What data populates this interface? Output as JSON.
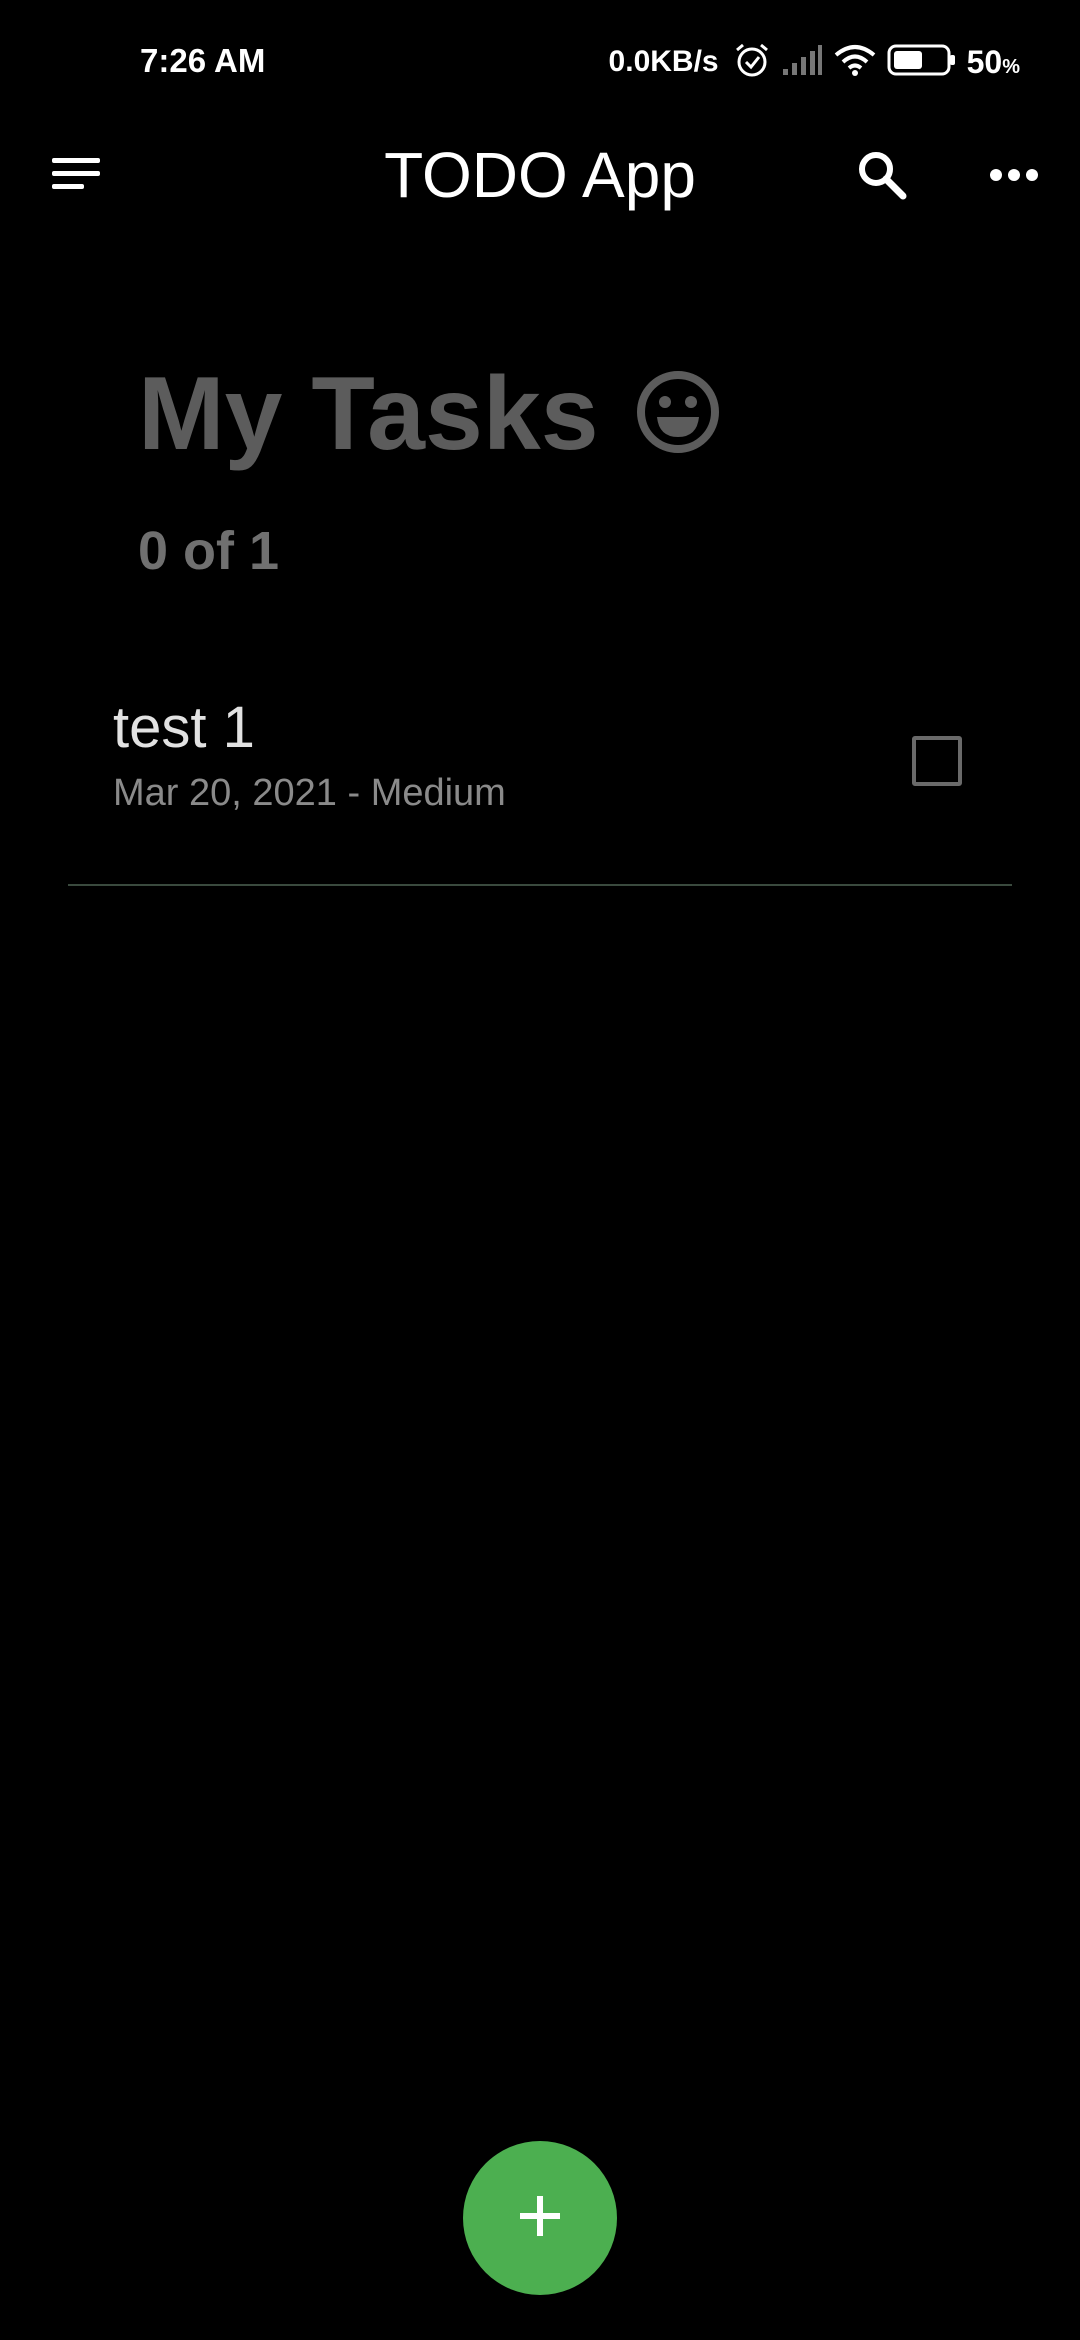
{
  "status_bar": {
    "time": "7:26 AM",
    "net_speed": "0.0KB/s",
    "battery_value": "50",
    "battery_unit": "%",
    "icons": [
      "alarm-icon",
      "signal-icon",
      "wifi-icon",
      "battery-icon"
    ]
  },
  "app_bar": {
    "title": "TODO App",
    "icons": [
      "menu-icon",
      "search-icon",
      "more-icon"
    ]
  },
  "main": {
    "heading": "My Tasks",
    "heading_icon": "smiley-icon",
    "count_text": "0 of 1"
  },
  "tasks": [
    {
      "title": "test 1",
      "meta": "Mar 20, 2021 - Medium",
      "checked": false
    }
  ],
  "fab": {
    "icon": "plus-icon"
  },
  "colors": {
    "background": "#000000",
    "heading": "#5c5c5c",
    "fab": "#4caf50",
    "divider": "#3a4a3e"
  }
}
